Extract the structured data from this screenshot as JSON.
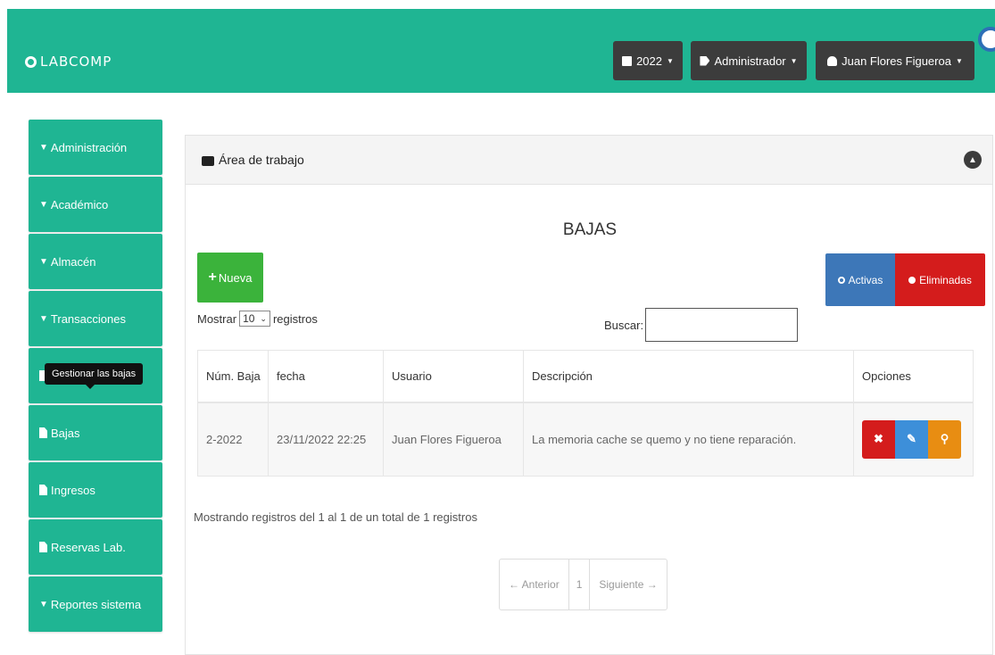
{
  "header": {
    "brand": "LABCOMP",
    "year_label": "2022",
    "role_label": "Administrador",
    "user_label": "Juan Flores Figueroa"
  },
  "sidebar": {
    "items": [
      {
        "label": "Administración",
        "icon": "chevron-down-icon"
      },
      {
        "label": "Académico",
        "icon": "chevron-down-icon"
      },
      {
        "label": "Almacén",
        "icon": "chevron-down-icon"
      },
      {
        "label": "Transacciones",
        "icon": "chevron-down-icon"
      },
      {
        "label": "",
        "icon": "file-icon"
      },
      {
        "label": "Bajas",
        "icon": "file-icon"
      },
      {
        "label": "Ingresos",
        "icon": "file-icon"
      },
      {
        "label": "Reservas Lab.",
        "icon": "file-icon"
      },
      {
        "label": "Reportes sistema",
        "icon": "chevron-down-icon"
      }
    ],
    "tooltip": "Gestionar las bajas"
  },
  "panel": {
    "heading": "Área de trabajo",
    "title": "BAJAS",
    "new_button": "Nueva",
    "active_button": "Activas",
    "deleted_button": "Eliminadas",
    "length_prefix": "Mostrar",
    "length_value": "10",
    "length_suffix": "registros",
    "search_label": "Buscar:",
    "search_value": ""
  },
  "table": {
    "headers": [
      "Núm. Baja",
      "fecha",
      "Usuario",
      "Descripción",
      "Opciones"
    ],
    "rows": [
      {
        "num": "2-2022",
        "fecha": "23/11/2022 22:25",
        "usuario": "Juan Flores Figueroa",
        "descripcion": "La memoria cache se quemo y no tiene reparación."
      }
    ]
  },
  "footer": {
    "info": "Mostrando registros del 1 al 1 de un total de 1 registros",
    "prev": "← Anterior",
    "page": "1",
    "next": "Siguiente →"
  },
  "colors": {
    "primary": "#1fb593",
    "dark_button": "#3c3c3c",
    "success": "#3bb33b",
    "info": "#3d77b8",
    "danger": "#d41c1c",
    "warning": "#e88d12"
  }
}
